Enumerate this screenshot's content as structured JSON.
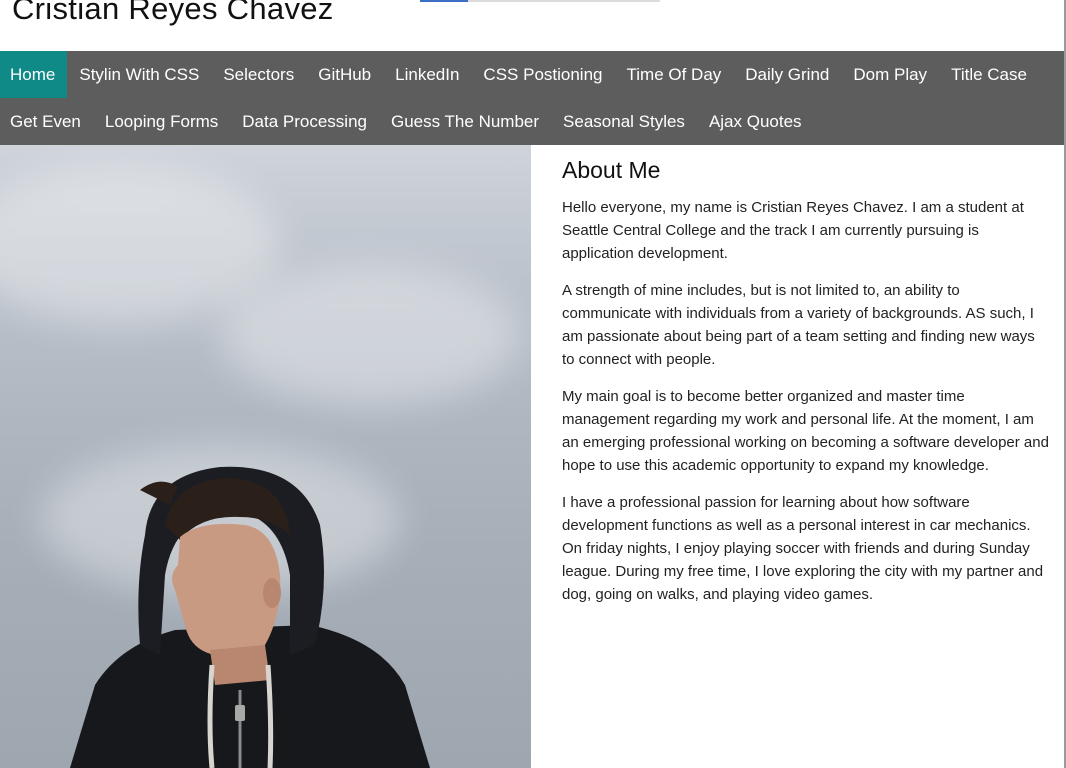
{
  "header": {
    "title": "Cristian Reyes Chavez"
  },
  "nav": {
    "row1": [
      "Home",
      "Stylin With CSS",
      "Selectors",
      "GitHub",
      "LinkedIn",
      "CSS Postioning",
      "Time Of Day",
      "Daily Grind",
      "Dom Play",
      "Title Case"
    ],
    "row2": [
      "Get Even",
      "Looping Forms",
      "Data Processing",
      "Guess The Number",
      "Seasonal Styles",
      "Ajax Quotes"
    ],
    "active": "Home"
  },
  "about": {
    "heading": "About Me",
    "paragraphs": [
      "Hello everyone, my name is Cristian Reyes Chavez. I am a student at Seattle Central College and the track I am currently pursuing is application development.",
      "A strength of mine includes, but is not limited to, an ability to communicate with individuals from a variety of backgrounds. AS such, I am passionate about being part of a team setting and finding new ways to connect with people.",
      "My main goal is to become better organized and master time management regarding my work and personal life. At the moment, I am an emerging professional working on becoming a software developer and hope to use this academic opportunity to expand my knowledge.",
      "I have a professional passion for learning about how software development functions as well as a personal interest in car mechanics. On friday nights, I enjoy playing soccer with friends and during Sunday league. During my free time, I love exploring the city with my partner and dog, going on walks, and playing video games."
    ]
  },
  "colors": {
    "nav_bg": "#5d5d5d",
    "nav_active": "#0f8a87",
    "nav_text": "#ffffff"
  },
  "photo": {
    "icon": "profile-photo"
  }
}
